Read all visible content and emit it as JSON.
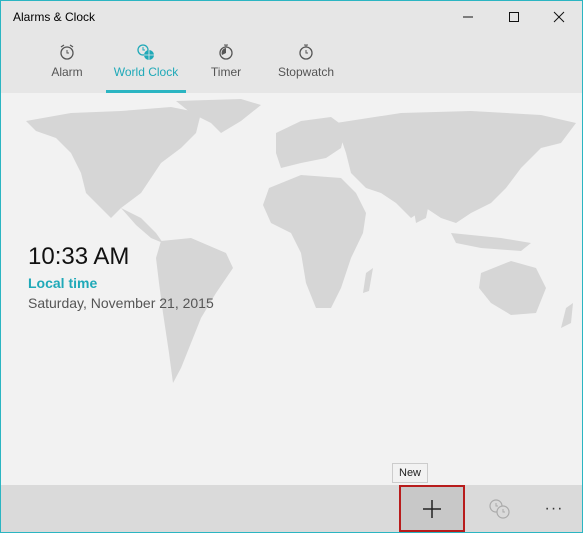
{
  "window": {
    "title": "Alarms & Clock",
    "controls": {
      "minimize": "–",
      "maximize": "☐",
      "close": "✕"
    }
  },
  "tabs": [
    {
      "label": "Alarm",
      "icon": "alarm-clock-icon",
      "active": false
    },
    {
      "label": "World Clock",
      "icon": "world-clock-icon",
      "active": true
    },
    {
      "label": "Timer",
      "icon": "timer-icon",
      "active": false
    },
    {
      "label": "Stopwatch",
      "icon": "stopwatch-icon",
      "active": false
    }
  ],
  "clock": {
    "time": "10:33 AM",
    "label": "Local time",
    "date": "Saturday, November 21, 2015"
  },
  "commandbar": {
    "new_label": "+",
    "tooltip": "New",
    "compare_icon": "compare-clocks-icon",
    "more_label": "···"
  },
  "colors": {
    "accent": "#2bb5c2",
    "highlight_border": "#b81c1c",
    "map_land": "#d6d6d6"
  }
}
